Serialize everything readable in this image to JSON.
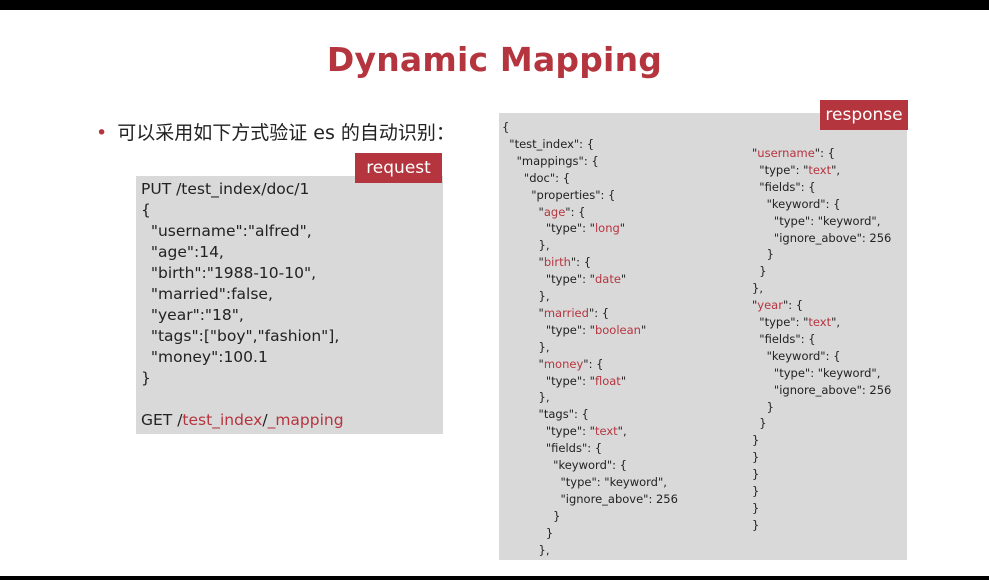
{
  "slide": {
    "title": "Dynamic Mapping",
    "bullet_marker": "•",
    "bullet_text": "可以采用如下方式验证 es 的自动识别："
  },
  "request": {
    "label": "request",
    "lines": [
      "PUT /test_index/doc/1",
      "{",
      "  \"username\":\"alfred\",",
      "  \"age\":14,",
      "  \"birth\":\"1988-10-10\",",
      "  \"married\":false,",
      "  \"year\":\"18\",",
      "  \"tags\":[\"boy\",\"fashion\"],",
      "  \"money\":100.1",
      "}"
    ],
    "get_prefix": "GET /",
    "get_index": "test_index",
    "get_sep": "/",
    "get_mapping": "_mapping"
  },
  "response": {
    "label": "response",
    "left_lines": [
      [
        {
          "t": "{"
        }
      ],
      [
        {
          "t": "  \"test_index\": {"
        }
      ],
      [
        {
          "t": "    \"mappings\": {"
        }
      ],
      [
        {
          "t": "      \"doc\": {"
        }
      ],
      [
        {
          "t": "        \"properties\": {"
        }
      ],
      [
        {
          "t": "          \""
        },
        {
          "t": "age",
          "c": "r"
        },
        {
          "t": "\": {"
        }
      ],
      [
        {
          "t": "            \"type\": \""
        },
        {
          "t": "long",
          "c": "r"
        },
        {
          "t": "\""
        }
      ],
      [
        {
          "t": "          },"
        }
      ],
      [
        {
          "t": "          \""
        },
        {
          "t": "birth",
          "c": "r"
        },
        {
          "t": "\": {"
        }
      ],
      [
        {
          "t": "            \"type\": \""
        },
        {
          "t": "date",
          "c": "r"
        },
        {
          "t": "\""
        }
      ],
      [
        {
          "t": "          },"
        }
      ],
      [
        {
          "t": "          \""
        },
        {
          "t": "married",
          "c": "r"
        },
        {
          "t": "\": {"
        }
      ],
      [
        {
          "t": "            \"type\": \""
        },
        {
          "t": "boolean",
          "c": "r"
        },
        {
          "t": "\""
        }
      ],
      [
        {
          "t": "          },"
        }
      ],
      [
        {
          "t": "          \""
        },
        {
          "t": "money",
          "c": "r"
        },
        {
          "t": "\": {"
        }
      ],
      [
        {
          "t": "            \"type\": \""
        },
        {
          "t": "float",
          "c": "r"
        },
        {
          "t": "\""
        }
      ],
      [
        {
          "t": "          },"
        }
      ],
      [
        {
          "t": "          \"tags\": {"
        }
      ],
      [
        {
          "t": "            \"type\": \""
        },
        {
          "t": "text",
          "c": "r"
        },
        {
          "t": "\","
        }
      ],
      [
        {
          "t": "            \"fields\": {"
        }
      ],
      [
        {
          "t": "              \"keyword\": {"
        }
      ],
      [
        {
          "t": "                \"type\": \"keyword\","
        }
      ],
      [
        {
          "t": "                \"ignore_above\": 256"
        }
      ],
      [
        {
          "t": "              }"
        }
      ],
      [
        {
          "t": "            }"
        }
      ],
      [
        {
          "t": "          },"
        }
      ]
    ],
    "right_lines": [
      [
        {
          "t": "\""
        },
        {
          "t": "username",
          "c": "r"
        },
        {
          "t": "\": {"
        }
      ],
      [
        {
          "t": "  \"type\": \""
        },
        {
          "t": "text",
          "c": "r"
        },
        {
          "t": "\","
        }
      ],
      [
        {
          "t": "  \"fields\": {"
        }
      ],
      [
        {
          "t": "    \"keyword\": {"
        }
      ],
      [
        {
          "t": "      \"type\": \"keyword\","
        }
      ],
      [
        {
          "t": "      \"ignore_above\": 256"
        }
      ],
      [
        {
          "t": "    }"
        }
      ],
      [
        {
          "t": "  }"
        }
      ],
      [
        {
          "t": "},"
        }
      ],
      [
        {
          "t": "\""
        },
        {
          "t": "year",
          "c": "r"
        },
        {
          "t": "\": {"
        }
      ],
      [
        {
          "t": "  \"type\": \""
        },
        {
          "t": "text",
          "c": "r"
        },
        {
          "t": "\","
        }
      ],
      [
        {
          "t": "  \"fields\": {"
        }
      ],
      [
        {
          "t": "    \"keyword\": {"
        }
      ],
      [
        {
          "t": "      \"type\": \"keyword\","
        }
      ],
      [
        {
          "t": "      \"ignore_above\": 256"
        }
      ],
      [
        {
          "t": "    }"
        }
      ],
      [
        {
          "t": "  }"
        }
      ],
      [
        {
          "t": "}"
        }
      ],
      [
        {
          "t": "}"
        }
      ],
      [
        {
          "t": "}"
        }
      ],
      [
        {
          "t": "}"
        }
      ],
      [
        {
          "t": "}"
        }
      ],
      [
        {
          "t": "}"
        }
      ]
    ]
  },
  "colors": {
    "accent": "#b5353f",
    "code_bg": "#d9d9d9",
    "text": "#222222"
  }
}
